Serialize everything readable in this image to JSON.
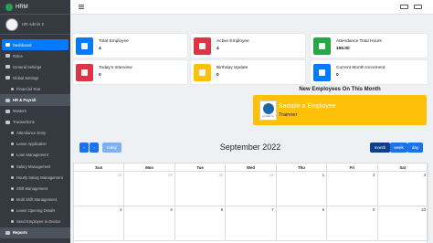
{
  "app": {
    "brand": "HRM",
    "user": "HR Admin 2"
  },
  "sidebar": {
    "items": [
      {
        "label": "Dashboard",
        "kind": "active"
      },
      {
        "label": "Roles",
        "kind": "top"
      },
      {
        "label": "General Settings",
        "kind": "top"
      },
      {
        "label": "Global Settings",
        "kind": "top"
      },
      {
        "label": "Financial Year",
        "kind": "sub"
      },
      {
        "label": "HR & Payroll",
        "kind": "header"
      },
      {
        "label": "Masters",
        "kind": "top"
      },
      {
        "label": "Transactions",
        "kind": "top"
      },
      {
        "label": "Attendance Entry",
        "kind": "sub"
      },
      {
        "label": "Leave Application",
        "kind": "sub"
      },
      {
        "label": "Loan Management",
        "kind": "sub"
      },
      {
        "label": "Salary Management",
        "kind": "sub"
      },
      {
        "label": "Hourly Salary Management",
        "kind": "sub"
      },
      {
        "label": "Shift Management",
        "kind": "sub"
      },
      {
        "label": "Multi Shift Management",
        "kind": "sub"
      },
      {
        "label": "Leave Opening Details",
        "kind": "sub"
      },
      {
        "label": "Send Employee to Device",
        "kind": "sub"
      },
      {
        "label": "Reports",
        "kind": "header"
      }
    ]
  },
  "cards": [
    {
      "label": "Total Employee",
      "value": "4",
      "color": "#007bff",
      "icon": "user-icon"
    },
    {
      "label": "Active Employee",
      "value": "4",
      "color": "#dc3545",
      "icon": "user-check-icon"
    },
    {
      "label": "Attendance Total Hours",
      "value": "196.00",
      "color": "#28a745",
      "icon": "clock-icon"
    },
    {
      "label": "Today's Interview",
      "value": "0",
      "color": "#dc3545",
      "icon": "interview-icon"
    },
    {
      "label": "Birthday Update",
      "value": "0",
      "color": "#ffc107",
      "icon": "birthday-icon"
    },
    {
      "label": "Current Month Increment",
      "value": "0",
      "color": "#007bff",
      "icon": "increment-icon"
    }
  ],
  "new_employees": {
    "title": "New Employees On This Month",
    "employee": {
      "name": "Sample a Employee",
      "role": "Trainner",
      "logo_text": "Le Cafe Inn"
    }
  },
  "calendar": {
    "title": "September 2022",
    "today_label": "today",
    "views": [
      "month",
      "week",
      "day"
    ],
    "days": [
      "Sun",
      "Mon",
      "Tue",
      "Wed",
      "Thu",
      "Fri",
      "Sat"
    ],
    "rows": [
      [
        {
          "d": "28",
          "o": true
        },
        {
          "d": "29",
          "o": true
        },
        {
          "d": "30",
          "o": true
        },
        {
          "d": "31",
          "o": true
        },
        {
          "d": "1",
          "o": false
        },
        {
          "d": "2",
          "o": false
        },
        {
          "d": "3",
          "o": false
        }
      ],
      [
        {
          "d": "4",
          "o": false
        },
        {
          "d": "5",
          "o": false
        },
        {
          "d": "6",
          "o": false
        },
        {
          "d": "7",
          "o": false
        },
        {
          "d": "8",
          "o": false
        },
        {
          "d": "9",
          "o": false
        },
        {
          "d": "10",
          "o": false
        }
      ]
    ]
  },
  "colors": {
    "sidebar_bg": "#343a40",
    "primary": "#007bff",
    "warning": "#ffc107"
  }
}
